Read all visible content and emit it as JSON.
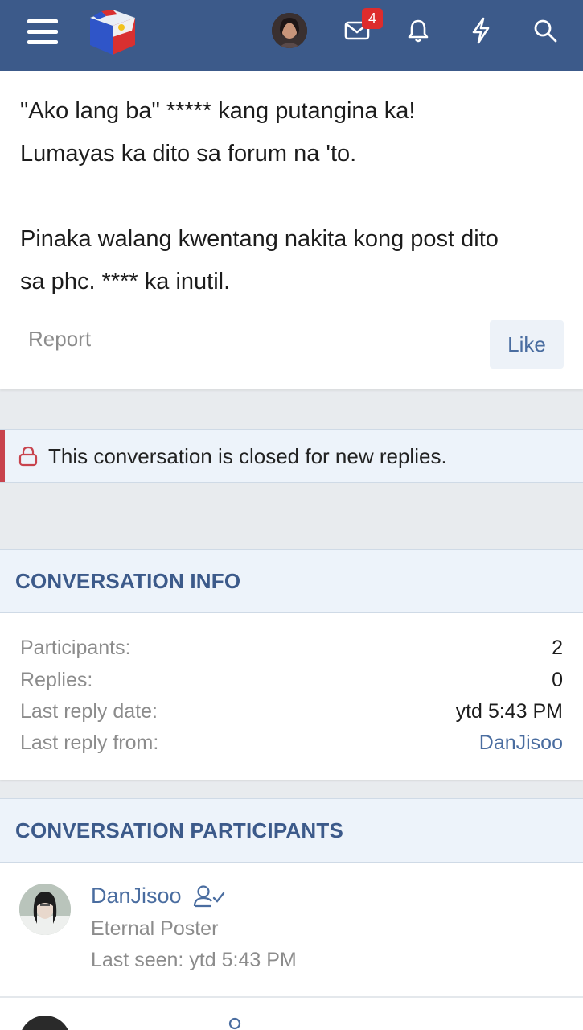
{
  "header": {
    "icons": [
      "menu-icon",
      "site-logo",
      "user-avatar",
      "inbox-icon",
      "bell-icon",
      "bolt-icon",
      "search-icon"
    ],
    "inbox_badge": "4",
    "colors": {
      "bar": "#3c5a8a",
      "badge": "#dd2c2c"
    }
  },
  "message": {
    "lines": [
      "\"Ako lang ba\" ***** kang putangina ka!",
      "Lumayas ka dito sa forum na 'to.",
      "Pinaka walang kwentang nakita kong post dito",
      "sa phc. **** ka inutil."
    ],
    "report_label": "Report",
    "like_label": "Like"
  },
  "notice": {
    "text": "This conversation is closed for new replies.",
    "icon": "lock-icon"
  },
  "info": {
    "title": "CONVERSATION INFO",
    "rows": [
      {
        "label": "Participants:",
        "value": "2"
      },
      {
        "label": "Replies:",
        "value": "0"
      },
      {
        "label": "Last reply date:",
        "value": "ytd 5:43 PM"
      },
      {
        "label": "Last reply from:",
        "value": "DanJisoo"
      }
    ]
  },
  "participants": {
    "title": "CONVERSATION PARTICIPANTS",
    "items": [
      {
        "name": "DanJisoo",
        "user_title": "Eternal Poster",
        "last_seen": "Last seen: ytd 5:43 PM"
      }
    ]
  }
}
